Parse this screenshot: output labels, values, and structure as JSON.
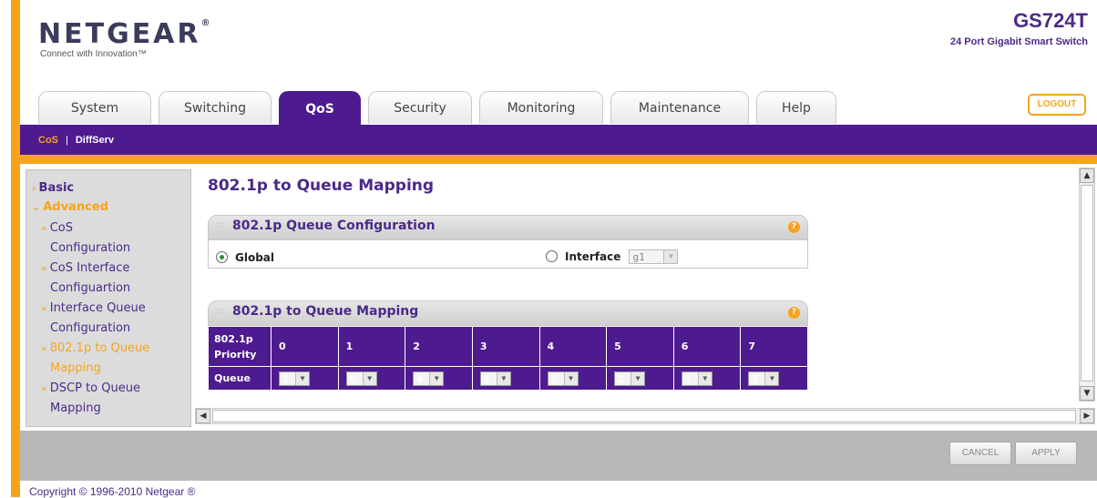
{
  "header": {
    "logo": "NETGEAR",
    "logo_mark": "®",
    "tagline": "Connect with Innovation™",
    "model": "GS724T",
    "model_desc": "24 Port Gigabit Smart Switch",
    "logout_label": "LOGOUT"
  },
  "tabs": [
    {
      "label": "System",
      "active": false
    },
    {
      "label": "Switching",
      "active": false
    },
    {
      "label": "QoS",
      "active": true
    },
    {
      "label": "Security",
      "active": false
    },
    {
      "label": "Monitoring",
      "active": false
    },
    {
      "label": "Maintenance",
      "active": false
    },
    {
      "label": "Help",
      "active": false
    }
  ],
  "subnav": {
    "items": [
      "CoS",
      "DiffServ"
    ],
    "separator": "|",
    "active": "CoS"
  },
  "sidebar": {
    "basic": "Basic",
    "advanced": "Advanced",
    "items": [
      {
        "label": "CoS Configuration",
        "line1": "CoS",
        "line2": "Configuration",
        "active": false
      },
      {
        "label": "CoS Interface Configuartion",
        "line1": "CoS Interface",
        "line2": "Configuartion",
        "active": false
      },
      {
        "label": "Interface Queue Configuration",
        "line1": "Interface Queue",
        "line2": "Configuration",
        "active": false
      },
      {
        "label": "802.1p to Queue Mapping",
        "line1": "802.1p to Queue",
        "line2": "Mapping",
        "active": true
      },
      {
        "label": "DSCP to Queue Mapping",
        "line1": "DSCP to Queue",
        "line2": "Mapping",
        "active": false
      }
    ]
  },
  "main": {
    "page_title": "802.1p to Queue Mapping",
    "config_panel": {
      "title": "802.1p Queue Configuration",
      "global_label": "Global",
      "global_selected": true,
      "interface_label": "Interface",
      "interface_value": "g1"
    },
    "mapping_panel": {
      "title": "802.1p to Queue Mapping",
      "priority_label_1": "802.1p",
      "priority_label_2": "Priority",
      "queue_label": "Queue",
      "priorities": [
        "0",
        "1",
        "2",
        "3",
        "4",
        "5",
        "6",
        "7"
      ],
      "queues": [
        "1",
        "0",
        "0",
        "1",
        "2",
        "2",
        "3",
        "3"
      ]
    },
    "help_glyph": "?"
  },
  "buttons": {
    "cancel": "CANCEL",
    "apply": "APPLY"
  },
  "footer": {
    "copyright": "Copyright © 1996-2010 Netgear ®"
  },
  "colors": {
    "brand_purple": "#4d1a8f",
    "accent_orange": "#f6a41c"
  }
}
